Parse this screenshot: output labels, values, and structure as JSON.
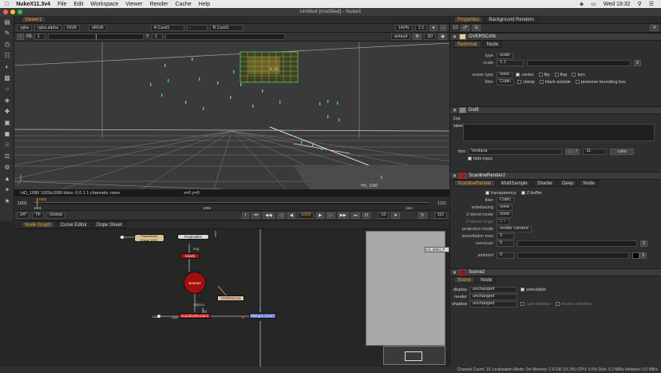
{
  "mac": {
    "app": "NukeX11.3v4",
    "menus": [
      "File",
      "Edit",
      "Workspace",
      "Viewer",
      "Render",
      "Cache",
      "Help"
    ],
    "clock": "Wed 18:32"
  },
  "window_title": "Untitled [modified] - NukeX",
  "viewer": {
    "tab": "Viewer1",
    "channels": "rgba",
    "alpha": "rgba.alpha",
    "colorspace": "RGB",
    "lut": "sRGB",
    "a_input": "A Card1",
    "b_input": "B Card1",
    "dash": "-",
    "fstop": "f/8",
    "gain_val": "1",
    "gamma_label": "Y",
    "gamma_val": "1",
    "zoom": "140%",
    "ratio": "1:1",
    "mode": "3D",
    "proxy": "default",
    "status": "HD_1080 1920x1080  bbox: 0 0 1 1 channels: none",
    "coords": "x=0 y=0",
    "corner_label": "HD_1080",
    "overlay_label": "OVERSCAN",
    "card_label": "B_1%"
  },
  "timeline": {
    "start": "1001",
    "end": "1111",
    "mid": "1055",
    "marker": "1003",
    "tick_a": "1001",
    "tick_b": "1111",
    "fps": "24*",
    "tf": "TF",
    "global": "Global",
    "frame": "1003",
    "step": "10",
    "end_box": "111",
    "inc": "1"
  },
  "tabs_bottom": [
    "Node Graph",
    "Curve Editor",
    "Dope Sheet"
  ],
  "nodes": {
    "read": "FrameHold2\n(frame 1001)",
    "project": "Project3D1",
    "card": "Card1",
    "scene": "Scene2",
    "scanline": "ScanlineRender2",
    "merge": "Merge1 (over)",
    "overscan": "OVERSCAN",
    "img_label": "img",
    "cam_label": "cam",
    "obj_label": "obj/scn",
    "bg_label": "bg",
    "a_label": "A",
    "ld_label": "LD_3DE4_P"
  },
  "status_bar": "Channel Count: 19  Localization Mode: On  Memory: 2.6 GB (16.3%)  CPU: 9.6%  Disk: 0.2 MB/s  Network: 0.0 MB/s",
  "props": {
    "tab_a": "Properties",
    "tab_b": "Background Renders",
    "count": "10",
    "overscan": {
      "title": "OVERSCAN",
      "tabs": [
        "Reformat",
        "Node"
      ],
      "type_label": "type",
      "type_val": "scale",
      "scale_label": "scale",
      "scale_val": "1.1",
      "scale_badge": "2",
      "resize_label": "resize type",
      "resize_val": "none",
      "center": "center",
      "flip": "flip",
      "flop": "flop",
      "turn": "turn",
      "filter_label": "filter",
      "filter_val": "Cubic",
      "clamp": "clamp",
      "black": "black outside",
      "bbox": "preserve bounding box"
    },
    "dot": {
      "title": "Dot5",
      "tab": "Dot",
      "label_label": "label",
      "font_label": "font",
      "font_val": "Verdana",
      "size_val": "11",
      "color_btn": "color",
      "hide_input": "hide input"
    },
    "scanline": {
      "title": "ScanlineRender2",
      "tabs": [
        "ScanlineRender",
        "MultiSample",
        "Shader",
        "Deep",
        "Node"
      ],
      "transparency": "transparency",
      "zbuffer": "Z-buffer",
      "filter_label": "filter",
      "filter_val": "Cubic",
      "antialias_label": "antialiasing",
      "antialias_val": "none",
      "zblend_label": "Z-blend mode",
      "zblend_val": "none",
      "zrange_label": "Z-blend range",
      "zrange_val": "0.1",
      "proj_label": "projection mode",
      "proj_val": "render camera",
      "tess_label": "tessellation max",
      "tess_val": "3",
      "overscan_label": "overscan",
      "overscan_val": "0",
      "overscan_badge": "2",
      "ambient_label": "ambient",
      "ambient_val": "0",
      "ambient_badge": "3"
    },
    "scene": {
      "title": "Scene2",
      "tabs": [
        "Scene",
        "Node"
      ],
      "display_label": "display",
      "display_val": "unchanged",
      "selectable": "selectable",
      "render_label": "render",
      "render_val": "unchanged",
      "shadow_label": "shadow",
      "shadow_val": "unchanged",
      "cast": "cast shadow",
      "receive": "receive shadow"
    }
  },
  "colors": {
    "accent": "#f0a030",
    "node_red": "#b01414",
    "node_blue": "#5b74c9",
    "node_cream": "#d9c38f",
    "green_grid": "#3fd77a"
  }
}
